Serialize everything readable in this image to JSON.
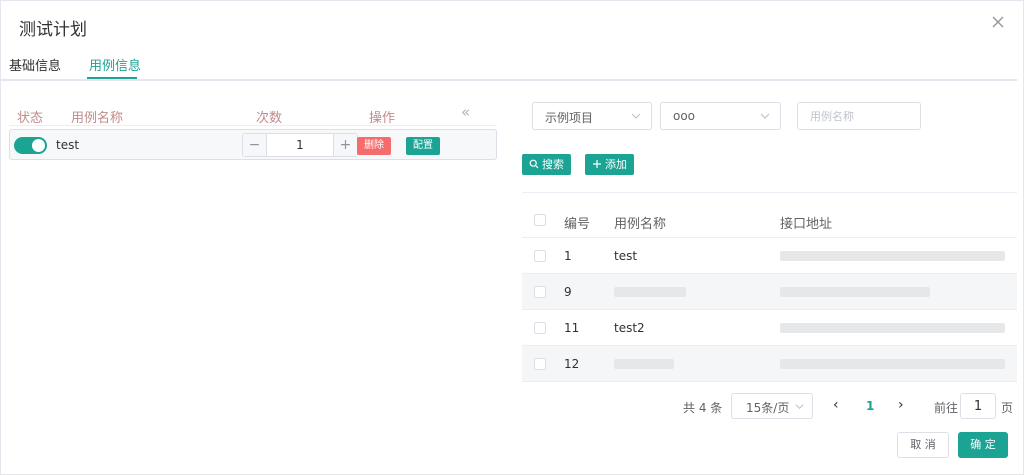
{
  "dialog": {
    "title": "测试计划",
    "tabs": [
      {
        "label": "基础信息",
        "active": false
      },
      {
        "label": "用例信息",
        "active": true
      }
    ]
  },
  "left": {
    "headers": {
      "status": "状态",
      "name": "用例名称",
      "count": "次数",
      "ops": "操作"
    },
    "rows": [
      {
        "enabled": true,
        "name": "test",
        "count": "1",
        "delete_label": "删除",
        "config_label": "配置"
      }
    ],
    "stepper": {
      "minus": "−",
      "plus": "+"
    }
  },
  "right": {
    "filters": {
      "project": "示例项目",
      "module": "ooo",
      "name_placeholder": "用例名称"
    },
    "buttons": {
      "search": "搜索",
      "add": "添加"
    },
    "table": {
      "headers": {
        "no": "编号",
        "name": "用例名称",
        "addr": "接口地址"
      },
      "rows": [
        {
          "no": "1",
          "name": "test",
          "addr": ""
        },
        {
          "no": "9",
          "name": "",
          "addr": ""
        },
        {
          "no": "11",
          "name": "test2",
          "addr": ""
        },
        {
          "no": "12",
          "name": "",
          "addr": ""
        }
      ]
    },
    "pagination": {
      "total": "共 4 条",
      "page_size": "15条/页",
      "current": "1",
      "goto_label": "前往",
      "goto_value": "1",
      "page_unit": "页"
    }
  },
  "footer": {
    "cancel": "取 消",
    "confirm": "确 定"
  },
  "colors": {
    "accent": "#1ba394",
    "danger": "#f56c6c"
  }
}
